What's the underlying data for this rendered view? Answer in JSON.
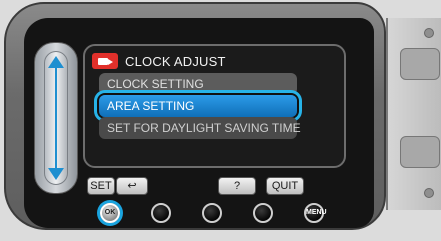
{
  "menu": {
    "title": "CLOCK ADJUST",
    "items": [
      {
        "label": "CLOCK SETTING"
      },
      {
        "label": "AREA SETTING"
      },
      {
        "label": "SET FOR DAYLIGHT SAVING TIME"
      }
    ],
    "selected_index": 1
  },
  "soft_buttons": {
    "set": "SET",
    "back": "↩",
    "help": "?",
    "quit": "QUIT"
  },
  "hardware_buttons": {
    "ok": "OK",
    "menu": "MENU"
  },
  "icons": {
    "menu_icon": "camera-icon",
    "scroll_up": "arrow-up-icon",
    "scroll_down": "arrow-down-icon"
  },
  "colors": {
    "accent": "#1aa4df",
    "selected_bg": "#1f86d0",
    "item_bg": "#5c5c5c",
    "camera_icon": "#e1302b"
  }
}
